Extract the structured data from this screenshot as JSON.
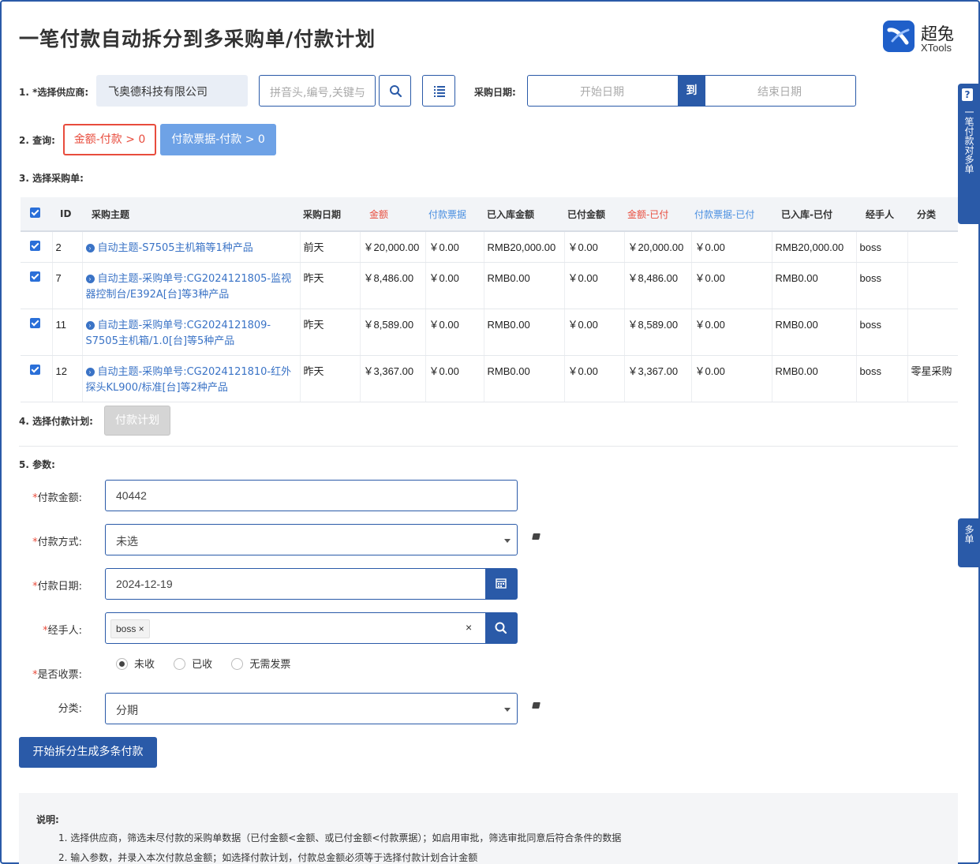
{
  "header": {
    "title": "一笔付款自动拆分到多采购单/付款计划",
    "logo_cn": "超兔",
    "logo_en": "XTools"
  },
  "step1": {
    "label": "1. *选择供应商:",
    "supplier_value": "飞奥德科技有限公司",
    "search_placeholder": "拼音头,编号,关键与",
    "date_label": "采购日期:",
    "start_placeholder": "开始日期",
    "to_label": "到",
    "end_placeholder": "结束日期"
  },
  "step2": {
    "label": "2. 查询:",
    "btn_amount": "金额-付款 > 0",
    "btn_receipt": "付款票据-付款 > 0"
  },
  "step3": {
    "label": "3. 选择采购单:",
    "columns": [
      "ID",
      "采购主题",
      "采购日期",
      "金额",
      "付款票据",
      "已入库金额",
      "已付金额",
      "金额-已付",
      "付款票据-已付",
      "已入库-已付",
      "经手人",
      "分类"
    ],
    "rows": [
      {
        "id": "2",
        "subject": "自动主题-S7505主机箱等1种产品",
        "date": "前天",
        "amount": "￥20,000.00",
        "receipt": "￥0.00",
        "stocked": "RMB20,000.00",
        "paid": "￥0.00",
        "amount_minus_paid": "￥20,000.00",
        "receipt_minus_paid": "￥0.00",
        "stocked_minus_paid": "RMB20,000.00",
        "handler": "boss",
        "category": ""
      },
      {
        "id": "7",
        "subject": "自动主题-采购单号:CG2024121805-监视器控制台/E392A[台]等3种产品",
        "date": "昨天",
        "amount": "￥8,486.00",
        "receipt": "￥0.00",
        "stocked": "RMB0.00",
        "paid": "￥0.00",
        "amount_minus_paid": "￥8,486.00",
        "receipt_minus_paid": "￥0.00",
        "stocked_minus_paid": "RMB0.00",
        "handler": "boss",
        "category": ""
      },
      {
        "id": "11",
        "subject": "自动主题-采购单号:CG2024121809-S7505主机箱/1.0[台]等5种产品",
        "date": "昨天",
        "amount": "￥8,589.00",
        "receipt": "￥0.00",
        "stocked": "RMB0.00",
        "paid": "￥0.00",
        "amount_minus_paid": "￥8,589.00",
        "receipt_minus_paid": "￥0.00",
        "stocked_minus_paid": "RMB0.00",
        "handler": "boss",
        "category": ""
      },
      {
        "id": "12",
        "subject": "自动主题-采购单号:CG2024121810-红外探头KL900/标准[台]等2种产品",
        "date": "昨天",
        "amount": "￥3,367.00",
        "receipt": "￥0.00",
        "stocked": "RMB0.00",
        "paid": "￥0.00",
        "amount_minus_paid": "￥3,367.00",
        "receipt_minus_paid": "￥0.00",
        "stocked_minus_paid": "RMB0.00",
        "handler": "boss",
        "category": "零星采购"
      }
    ]
  },
  "step4": {
    "label": "4. 选择付款计划:",
    "btn": "付款计划"
  },
  "step5": {
    "label": "5. 参数:",
    "amount_label": "付款金额:",
    "amount_value": "40442",
    "method_label": "付款方式:",
    "method_value": "未选",
    "date_label": "付款日期:",
    "date_value": "2024-12-19",
    "handler_label": "经手人:",
    "handler_tag": "boss ×",
    "handler_clear": "×",
    "receipt_label": "是否收票:",
    "receipt_options": [
      "未收",
      "已收",
      "无需发票"
    ],
    "category_label": "分类:",
    "category_value": "分期",
    "submit": "开始拆分生成多条付款"
  },
  "notes": {
    "title": "说明:",
    "items": [
      "1. 选择供应商，筛选未尽付款的采购单数据（已付金额<金额、或已付金额<付款票据）；如启用审批，筛选审批同意后符合条件的数据",
      "2. 输入参数，并录入本次付款总金额；如选择付款计划，付款总金额必须等于选择付款计划合计金额"
    ]
  },
  "side_tabs": {
    "top": "一笔付款对多单",
    "bottom": "多单"
  },
  "colors": {
    "primary": "#2a5aa8",
    "accent_red": "#e84c3d",
    "accent_blue": "#4a8fe0"
  }
}
